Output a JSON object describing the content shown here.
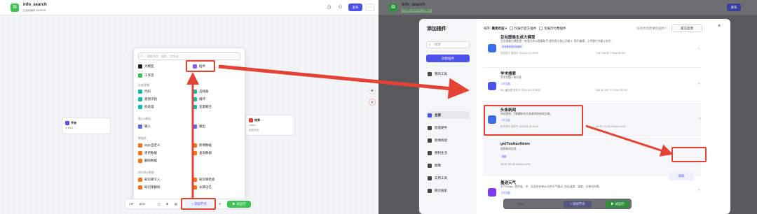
{
  "left": {
    "app": {
      "title": "info_search",
      "subtitle": "已自动保存 15:45:00"
    },
    "publish_label": "发布",
    "more_label": "···",
    "start_node": {
      "title": "开始",
      "body": "in input"
    },
    "end_node": {
      "title": "结束",
      "body_1": "output",
      "body_2": "回答内容"
    },
    "panel": {
      "search_placeholder": "搜索节点、插件、工作流",
      "items_top": [
        {
          "label": "大模型"
        },
        {
          "label": "插件"
        },
        {
          "label": "工作流"
        }
      ],
      "sections": [
        {
          "title": "业务逻辑",
          "items": [
            "代码",
            "选择器",
            "意图识别",
            "循环",
            "批处理",
            "变量聚合"
          ]
        },
        {
          "title": "输入&输出",
          "items": [
            "输入",
            "输出"
          ]
        },
        {
          "title": "数据库",
          "items": [
            "SQL自定义",
            "新增数据",
            "更新数据",
            "查询数据",
            "删除数据"
          ]
        },
        {
          "title": "知识库&数据",
          "items": [
            "知识库写入",
            "知识库检索",
            "知识库删除",
            "长期记忆"
          ]
        }
      ]
    },
    "toolbar": {
      "zoom": "82%",
      "add_node": "添加节点",
      "trial_run": "试运行"
    }
  },
  "right": {
    "app": {
      "title": "info_search",
      "status": "已发布 15:34:02 · 已保存"
    },
    "publish_label": "发布",
    "modal": {
      "title": "添加插件",
      "search_placeholder": "搜索",
      "create_button": "创建插件",
      "categories": [
        "我的工具",
        "全部",
        "智能硬件",
        "新闻阅读",
        "便利生活",
        "图像",
        "实用工具",
        "网页搜索"
      ],
      "sort_label": "排序:",
      "sort_value": "最受欢迎",
      "filter_1": "仅展示官方插件",
      "filter_2": "仅展示付费插件",
      "link_text": "没有找到想要的插件?",
      "feedback_button": "提交反馈",
      "close": "×",
      "cards": [
        {
          "name": "豆包图像生成大模型",
          "desc": "豆包图像大模型是一款强大的AI图像助手,提供两大核心功能:1. 图片编辑 - 上传图片并输入指令...",
          "tag": "字节跳动官方AI插件",
          "meta": "豆包官方 发布于 2024-10-17 20:52",
          "stats": "1.8K  145.6K  778ms  96.5%"
        },
        {
          "name": "学术搜索",
          "desc": "学术问题? 来问我",
          "tag": "1个工具",
          "meta": "Ms.·藏羽君 发布于 2024-09-18 08:52",
          "stats": "268.4K  160.7K  3.9ms  96.9%"
        },
        {
          "name": "头条新闻",
          "desc": "持续更新, 了解最新的头条新闻和新闻文章。",
          "tag": "1个工具",
          "meta": "扣子官方 发布于 2024-08-18 16:41",
          "stats": "40.9K  174.1K  393ms  100%"
        },
        {
          "name": "getToutiaoNews",
          "desc": "搜索新闻信息",
          "tag": "参数",
          "meta": "",
          "stats": "58.9K  150.9K  300ms  100%"
        },
        {
          "name": "墨迹天气",
          "desc": "天气Plugin, 提供省、市、区县的未来40天的天气情况, 包括温度、湿度、日夜风向等。",
          "tag": "1个工具",
          "meta": "",
          "stats": ""
        }
      ],
      "add_button": "添加"
    },
    "toolbar": {
      "zoom": "82%",
      "add_node": "添加节点",
      "trial_run": "试运行"
    }
  }
}
